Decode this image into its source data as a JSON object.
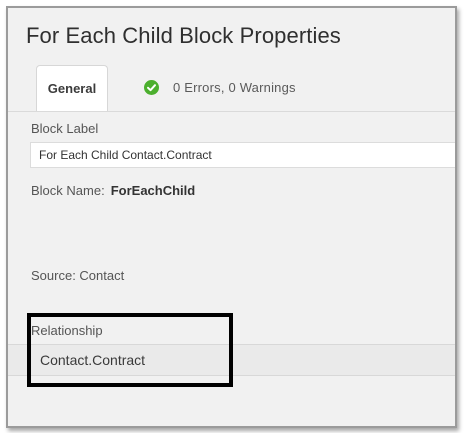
{
  "panel": {
    "title": "For Each Child Block Properties"
  },
  "tabs": [
    {
      "label": "General"
    }
  ],
  "status": {
    "text": "0 Errors, 0 Warnings",
    "icon": "check-circle-icon",
    "color": "#4caf2e"
  },
  "fields": {
    "block_label": {
      "label": "Block Label",
      "value": "For Each Child Contact.Contract"
    },
    "block_name": {
      "label": "Block Name:",
      "value": "ForEachChild"
    },
    "source": {
      "text": "Source: Contact"
    },
    "relationship": {
      "label": "Relationship",
      "value": "Contact.Contract"
    }
  }
}
